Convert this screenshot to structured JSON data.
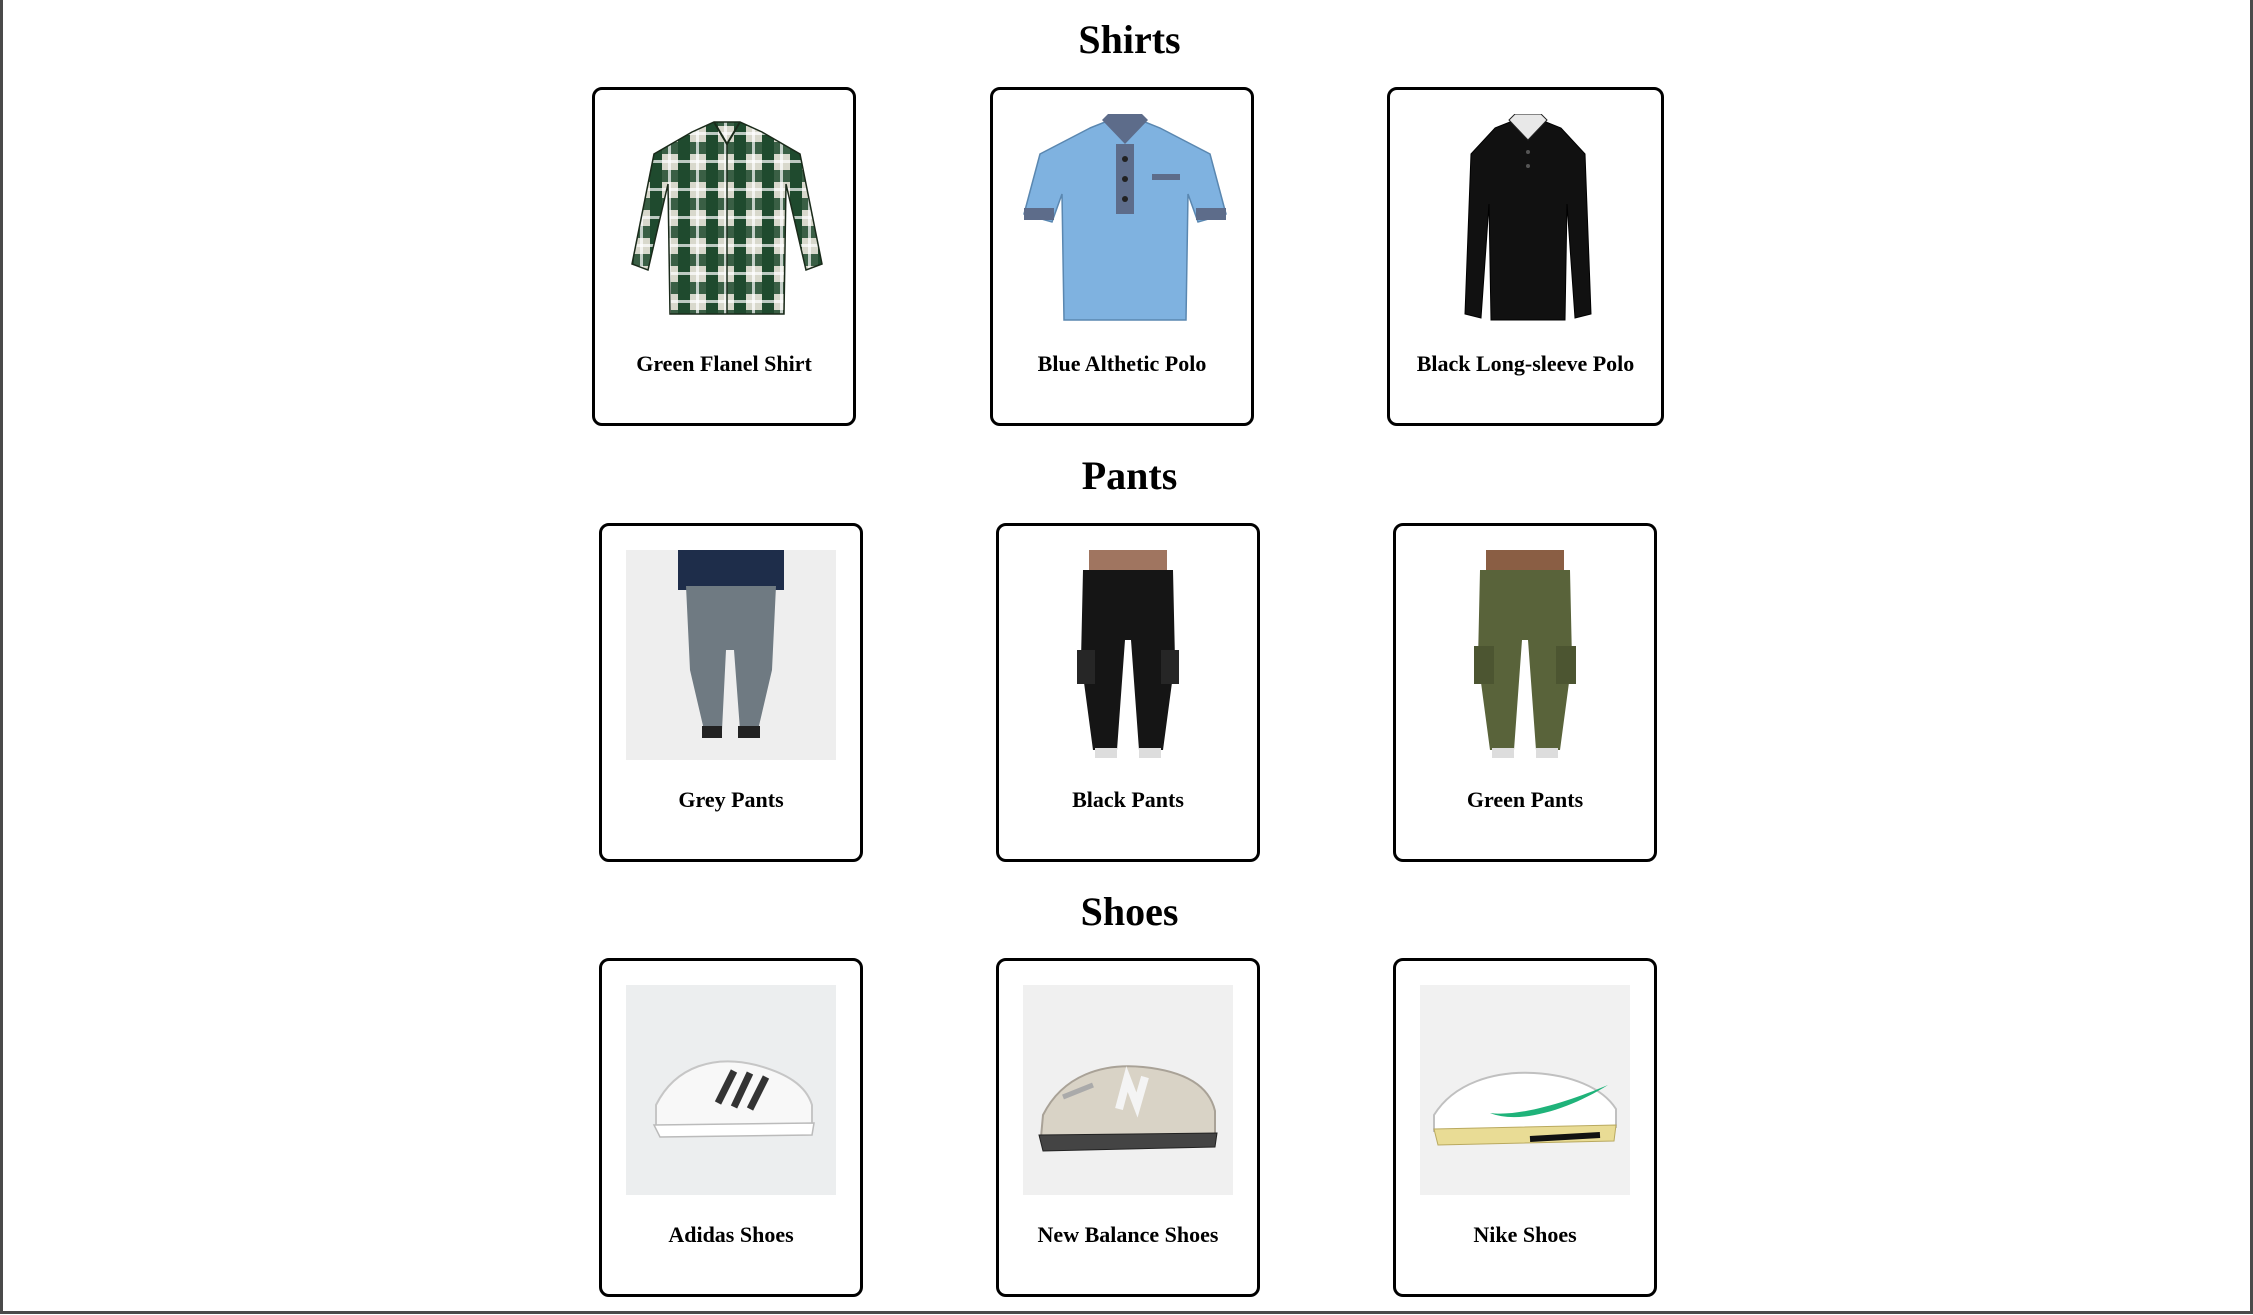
{
  "sections": [
    {
      "title": "Shirts",
      "items": [
        {
          "label": "Green Flanel Shirt",
          "image": "green-flannel-shirt"
        },
        {
          "label": "Blue Althetic Polo",
          "image": "blue-polo-shirt"
        },
        {
          "label": "Black Long-sleeve Polo",
          "image": "black-long-sleeve-polo"
        }
      ]
    },
    {
      "title": "Pants",
      "items": [
        {
          "label": "Grey Pants",
          "image": "grey-pants"
        },
        {
          "label": "Black Pants",
          "image": "black-cargo-pants"
        },
        {
          "label": "Green Pants",
          "image": "green-cargo-pants"
        }
      ]
    },
    {
      "title": "Shoes",
      "items": [
        {
          "label": "Adidas Shoes",
          "image": "adidas-sneaker"
        },
        {
          "label": "New Balance Shoes",
          "image": "new-balance-sneaker"
        },
        {
          "label": "Nike Shoes",
          "image": "nike-sneaker"
        }
      ]
    }
  ],
  "colors": {
    "card_border": "#000000",
    "page_background": "#ffffff",
    "frame_border": "#4a4a4a"
  }
}
